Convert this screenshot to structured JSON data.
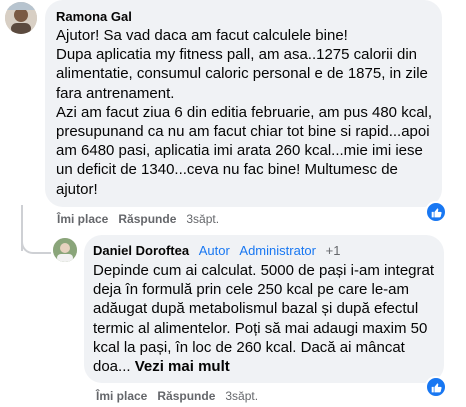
{
  "comments": [
    {
      "author": "Ramona Gal",
      "lines": [
        "Ajutor! Sa vad daca am facut calculele bine!",
        "Dupa aplicatia my fitness pall, am asa..1275 calorii din",
        "alimentatie, consumul caloric personal e de 1875, in zile",
        "fara antrenament.",
        "Azi am facut ziua 6 din editia februarie, am pus 480 kcal,",
        "presupunand ca nu am facut chiar tot bine si rapid...apoi",
        "am 6480 pasi, aplicatia imi arata 260 kcal...mie imi iese",
        "un deficit de 1340...ceva nu fac bine! Multumesc de",
        "ajutor!"
      ],
      "actions": {
        "like": "Îmi place",
        "reply": "Răspunde",
        "time": "3săpt."
      }
    },
    {
      "author": "Daniel Doroftea",
      "badges": {
        "author_tag": "Autor",
        "admin_tag": "Administrator",
        "plus": "+1"
      },
      "lines": [
        "Depinde cum ai calculat. 5000 de pași i-am integrat",
        "deja în formulă prin cele 250 kcal pe care le-am",
        "adăugat după metabolismul bazal și după efectul",
        "termic al alimentelor. Poți să mai adaugi maxim 50",
        "kcal la pași, în loc de 260 kcal. Dacă ai mâncat"
      ],
      "last_line": "doa...",
      "see_more": "Vezi mai mult",
      "actions": {
        "like": "Îmi place",
        "reply": "Răspunde",
        "time": "3săpt."
      }
    }
  ],
  "colors": {
    "bubble": "#f0f2f5",
    "accent": "#1877f2",
    "muted": "#65676b"
  }
}
